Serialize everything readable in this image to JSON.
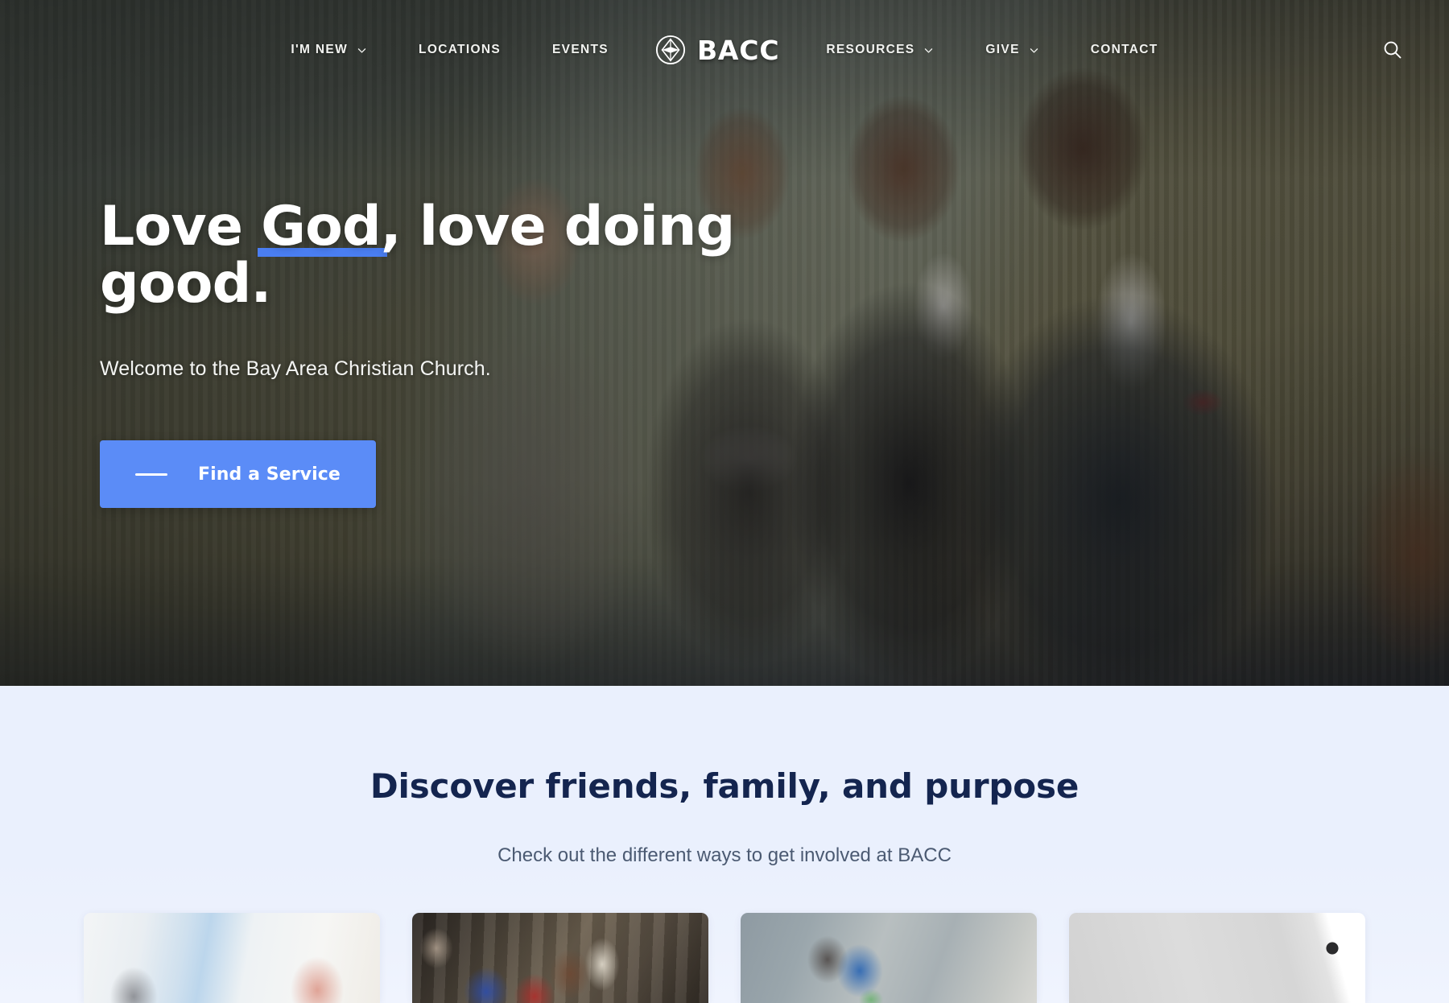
{
  "site": {
    "brand_name": "BACC",
    "brand_icon": "compass-emblem-icon"
  },
  "nav": {
    "left_items": [
      {
        "label": "I'M NEW",
        "has_dropdown": true,
        "icon": "chevron-down-icon"
      },
      {
        "label": "LOCATIONS",
        "has_dropdown": false
      },
      {
        "label": "EVENTS",
        "has_dropdown": false
      }
    ],
    "right_items": [
      {
        "label": "RESOURCES",
        "has_dropdown": true,
        "icon": "chevron-down-icon"
      },
      {
        "label": "GIVE",
        "has_dropdown": true,
        "icon": "chevron-down-icon"
      },
      {
        "label": "CONTACT",
        "has_dropdown": false
      }
    ],
    "search_icon": "search-icon"
  },
  "hero": {
    "title_part1": "Love ",
    "title_highlight": "God",
    "title_part2": ", love doing good.",
    "subtitle": "Welcome to the Bay Area Christian Church.",
    "cta_label": "Find a Service",
    "cta_color": "#5b8cf7",
    "underline_color": "#4a7ef2"
  },
  "involved": {
    "title_part1": "Discover friends, family, and ",
    "title_highlight": "purpose",
    "subtitle": "Check out the different ways to get involved at BACC",
    "title_color": "#14254f",
    "highlight_color": "#c7d9fb",
    "background_color": "#eaf0fd",
    "cards": [
      {
        "name": "card-kids-ministry"
      },
      {
        "name": "card-auditorium-gathering"
      },
      {
        "name": "card-serve-outreach"
      },
      {
        "name": "card-media-app"
      }
    ]
  }
}
